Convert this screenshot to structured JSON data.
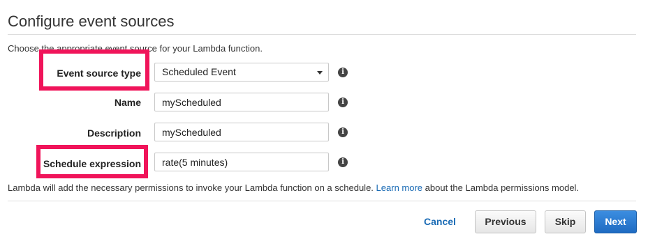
{
  "page": {
    "title": "Configure event sources",
    "intro": "Choose the appropriate event source for your Lambda function."
  },
  "form": {
    "event_source_type": {
      "label": "Event source type",
      "value": "Scheduled Event"
    },
    "name": {
      "label": "Name",
      "value": "myScheduled"
    },
    "description": {
      "label": "Description",
      "value": "myScheduled"
    },
    "schedule_expression": {
      "label": "Schedule expression",
      "value": "rate(5 minutes)"
    }
  },
  "permissions": {
    "text_before": "Lambda will add the necessary permissions to invoke your Lambda function on a schedule.",
    "link": "Learn more",
    "text_after": "about the Lambda permissions model."
  },
  "actions": {
    "cancel": "Cancel",
    "previous": "Previous",
    "skip": "Skip",
    "next": "Next"
  },
  "colors": {
    "highlight": "#f0145a",
    "link": "#1a6bb5",
    "primary": "#1f6bc2"
  },
  "icons": {
    "info": "i"
  }
}
